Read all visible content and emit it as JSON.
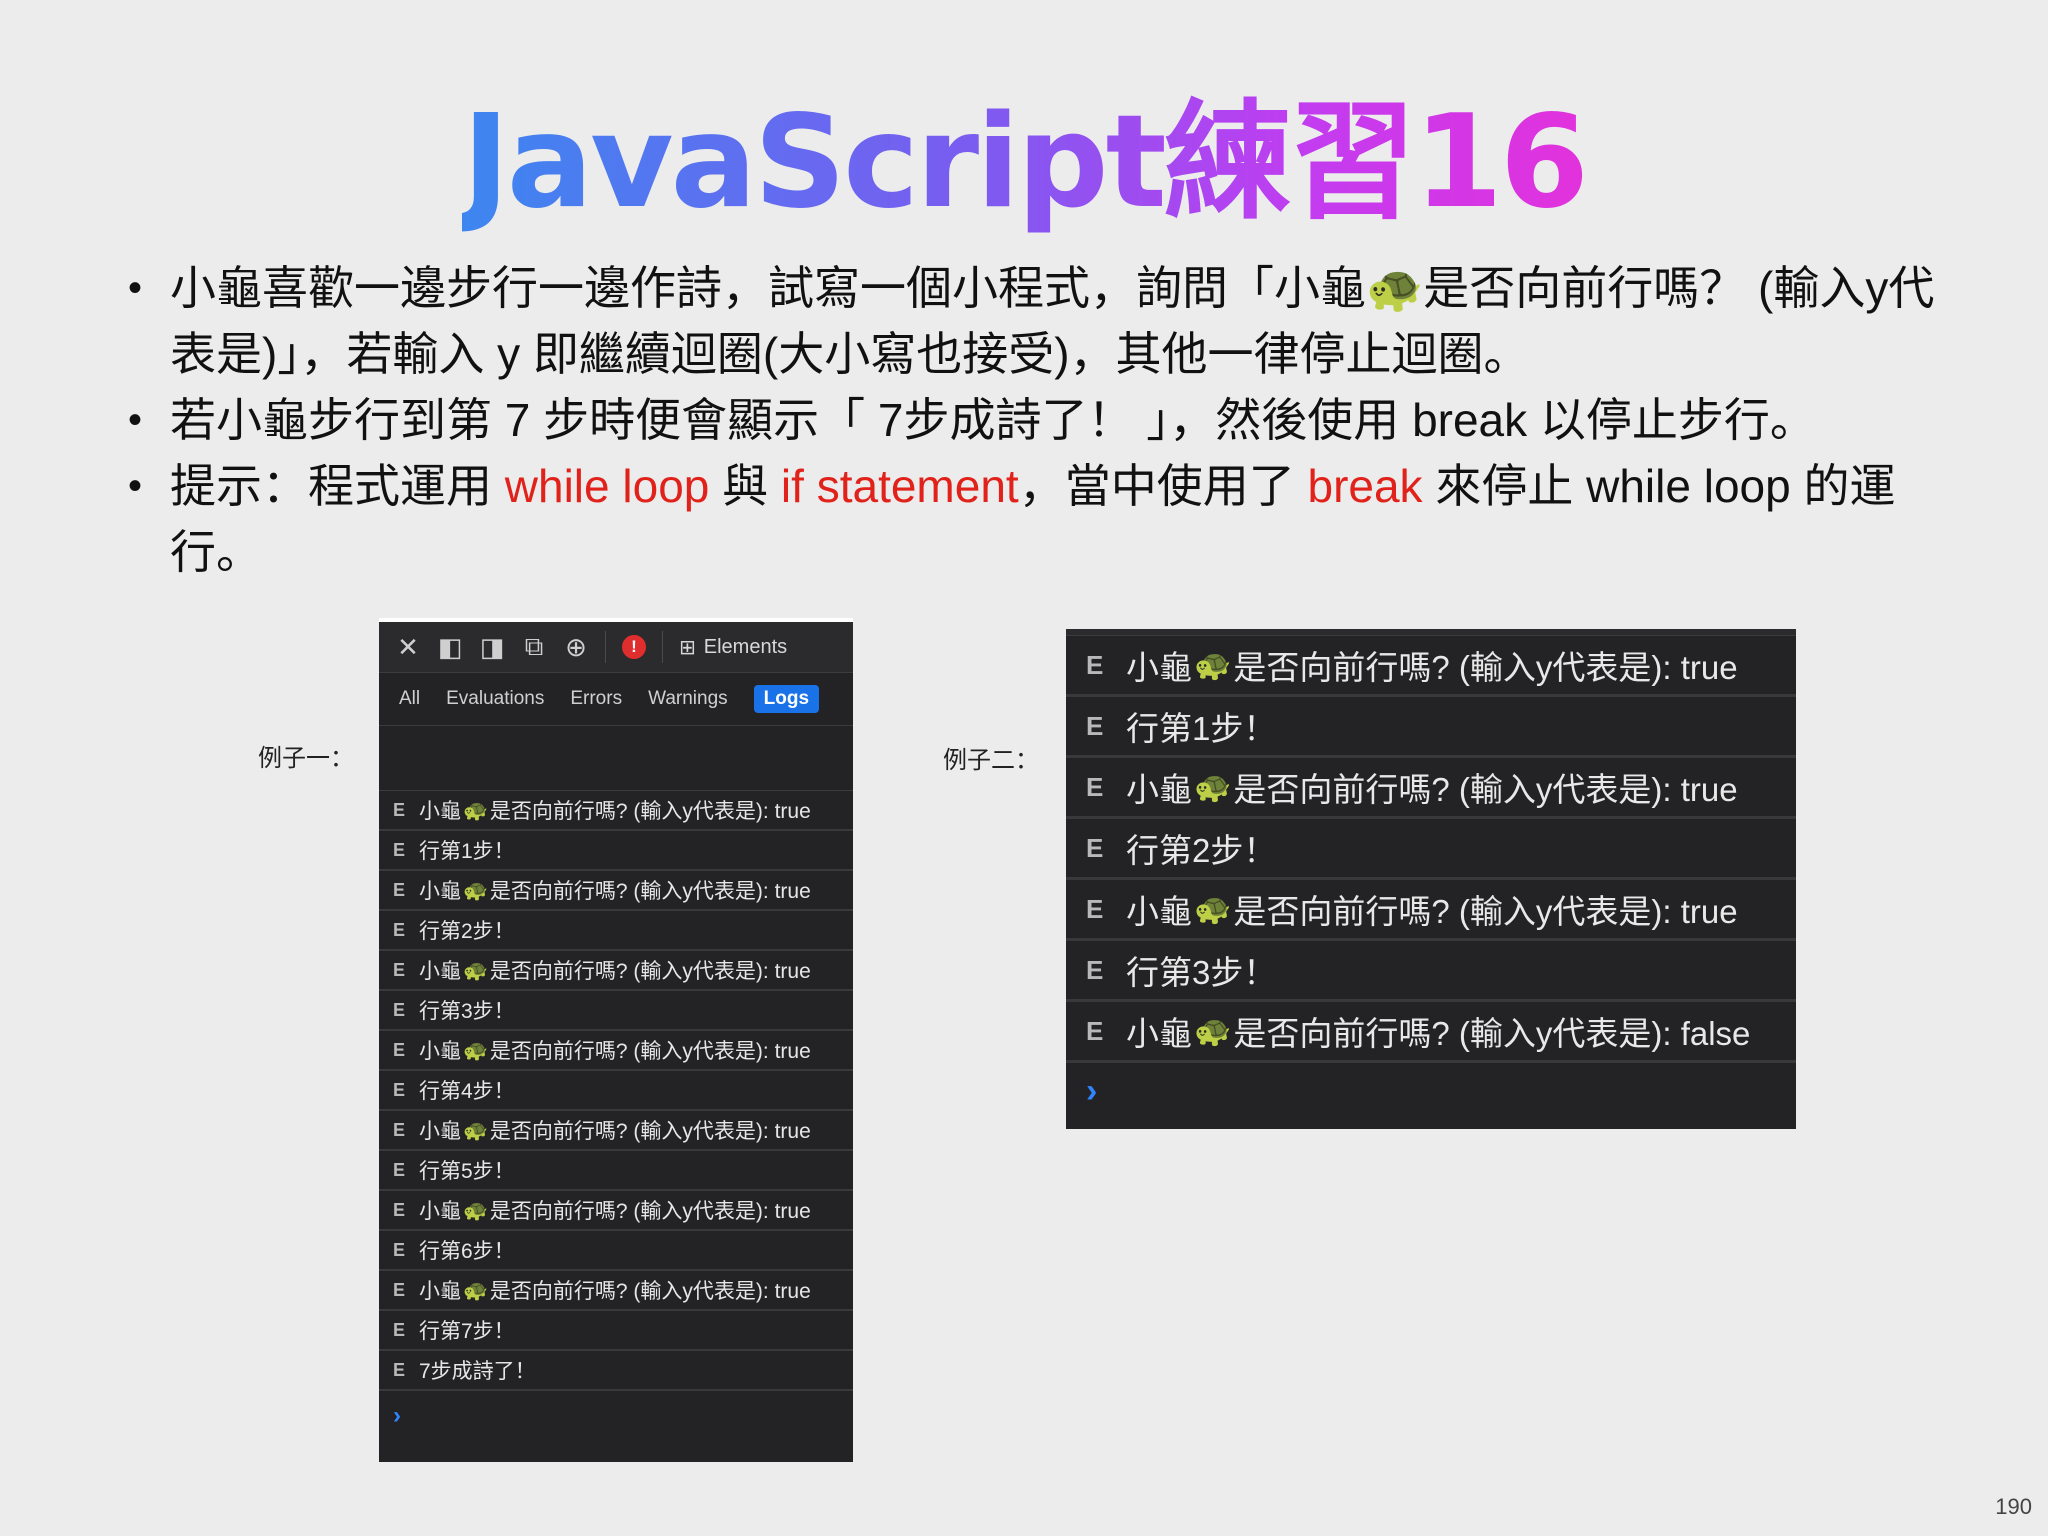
{
  "title": "JavaScript練習16",
  "bullets": {
    "b1": "小龜喜歡一邊步行一邊作詩，試寫一個小程式，詢問「小龜🐢是否向前行嗎？ (輸入y代表是)」，若輸入 y 即繼續迴圈(大小寫也接受)，其他一律停止迴圈。",
    "b2": "若小龜步行到第 7 步時便會顯示「 7步成詩了！ 」，然後使用 break 以停止步行。",
    "b3": {
      "p1": "提示：程式運用 ",
      "r1": "while loop",
      "p2": " 與 ",
      "r2": "if statement",
      "p3": "，當中使用了 ",
      "r3": "break",
      "p4": " 來停止 while loop 的運行。"
    }
  },
  "captions": {
    "ex1": "例子一：",
    "ex2": "例子二："
  },
  "console1": {
    "toolbar": {
      "elements_label": "Elements",
      "error_badge": "!"
    },
    "filters": [
      "All",
      "Evaluations",
      "Errors",
      "Warnings",
      "Logs"
    ],
    "active_filter": "Logs",
    "question_prefix": "小龜",
    "question_suffix": "是否向前行嗎? (輸入y代表是): true",
    "rows": [
      {
        "type": "q",
        "text": "是否向前行嗎? (輸入y代表是): true"
      },
      {
        "type": "s",
        "text": "行第1步！"
      },
      {
        "type": "q",
        "text": "是否向前行嗎? (輸入y代表是): true"
      },
      {
        "type": "s",
        "text": "行第2步！"
      },
      {
        "type": "q",
        "text": "是否向前行嗎? (輸入y代表是): true"
      },
      {
        "type": "s",
        "text": "行第3步！"
      },
      {
        "type": "q",
        "text": "是否向前行嗎? (輸入y代表是): true"
      },
      {
        "type": "s",
        "text": "行第4步！"
      },
      {
        "type": "q",
        "text": "是否向前行嗎? (輸入y代表是): true"
      },
      {
        "type": "s",
        "text": "行第5步！"
      },
      {
        "type": "q",
        "text": "是否向前行嗎? (輸入y代表是): true"
      },
      {
        "type": "s",
        "text": "行第6步！"
      },
      {
        "type": "q",
        "text": "是否向前行嗎? (輸入y代表是): true"
      },
      {
        "type": "s",
        "text": "行第7步！"
      },
      {
        "type": "s",
        "text": "7步成詩了！"
      }
    ],
    "prompt": "›"
  },
  "console2": {
    "rows": [
      {
        "type": "q",
        "text": "是否向前行嗎? (輸入y代表是): true"
      },
      {
        "type": "s",
        "text": "行第1步！"
      },
      {
        "type": "q",
        "text": "是否向前行嗎? (輸入y代表是): true"
      },
      {
        "type": "s",
        "text": "行第2步！"
      },
      {
        "type": "q",
        "text": "是否向前行嗎? (輸入y代表是): true"
      },
      {
        "type": "s",
        "text": "行第3步！"
      },
      {
        "type": "q",
        "text": "是否向前行嗎? (輸入y代表是): false"
      }
    ],
    "prompt": "›"
  },
  "turtle_glyph": "🐢",
  "page_number": "190",
  "colors": {
    "accent_red": "#e0221b",
    "logs_active": "#1a72e8",
    "prompt_blue": "#2f84ff"
  }
}
